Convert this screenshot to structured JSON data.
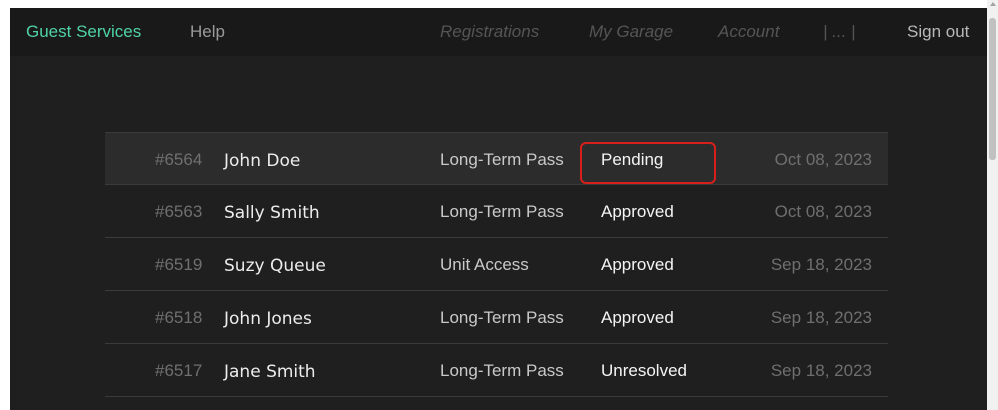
{
  "nav": {
    "brand": "Guest Services",
    "help": "Help",
    "registrations": "Registrations",
    "my_garage": "My Garage",
    "account": "Account",
    "more": "| ... |",
    "sign_out": "Sign out"
  },
  "colors": {
    "accent": "#4fd3a6",
    "highlight_outline": "#d8201a",
    "background": "#1f1f1f"
  },
  "registrations": [
    {
      "id": "#6564",
      "name": "John Doe",
      "type": "Long-Term Pass",
      "status": "Pending",
      "date": "Oct 08, 2023"
    },
    {
      "id": "#6563",
      "name": "Sally Smith",
      "type": "Long-Term Pass",
      "status": "Approved",
      "date": "Oct 08, 2023"
    },
    {
      "id": "#6519",
      "name": "Suzy Queue",
      "type": "Unit Access",
      "status": "Approved",
      "date": "Sep 18, 2023"
    },
    {
      "id": "#6518",
      "name": "John Jones",
      "type": "Long-Term Pass",
      "status": "Approved",
      "date": "Sep 18, 2023"
    },
    {
      "id": "#6517",
      "name": "Jane Smith",
      "type": "Long-Term Pass",
      "status": "Unresolved",
      "date": "Sep 18, 2023"
    }
  ]
}
